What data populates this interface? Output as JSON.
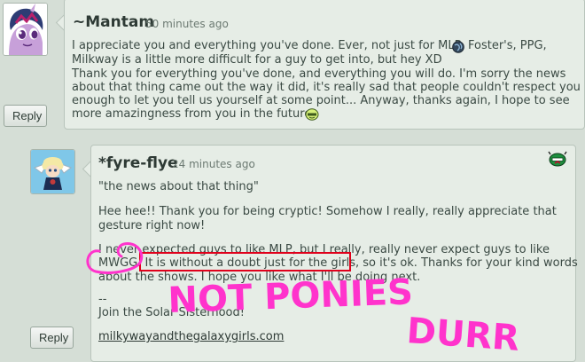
{
  "comment1": {
    "username": "~Mantam",
    "timestamp": "50 minutes ago",
    "reply_label": "Reply",
    "lines": [
      "I appreciate you and everything you've done. Ever, not just for MLP",
      "Foster's, PPG,",
      "Milkway is a little more difficult for a guy to get into, but hey XD",
      "Thank you for everything you've done, and everything you will do. I'm sorry the news",
      "about that thing came out the way it did, it's really sad that people couldn't respect you",
      "enough to let you tell us yourself at some point... Anyway, thanks again, I hope to see",
      "more amazingness from you in the future"
    ]
  },
  "comment2": {
    "username": "*fyre-flye",
    "timestamp": "24 minutes ago",
    "reply_label": "Reply",
    "quote": "\"the news about that thing\"",
    "para1": [
      "Hee hee!! Thank you for being cryptic! Somehow I really, really appreciate that",
      "gesture right now!"
    ],
    "para2": [
      "I never expected guys to like MLP, but I really, really never expect guys to like",
      "MWGG. It is without a doubt just for the girls, so it's ok. Thanks for your kind words",
      "about the shows. I hope you like what I'll be doing next."
    ],
    "sig_dashes": "--",
    "sig_line": "Join the Solar Sisterhood!",
    "sig_link": "milkywayandthegalaxygirls.com"
  },
  "annotation": {
    "scribble_line1": "NOT PONIES",
    "scribble_line2": "DURR",
    "highlight_color": "#e0001b",
    "scribble_color": "#ff33cc"
  },
  "colors": {
    "background": "#d5ded6",
    "comment_box": "#e6ede6",
    "text": "#3b4a44"
  }
}
